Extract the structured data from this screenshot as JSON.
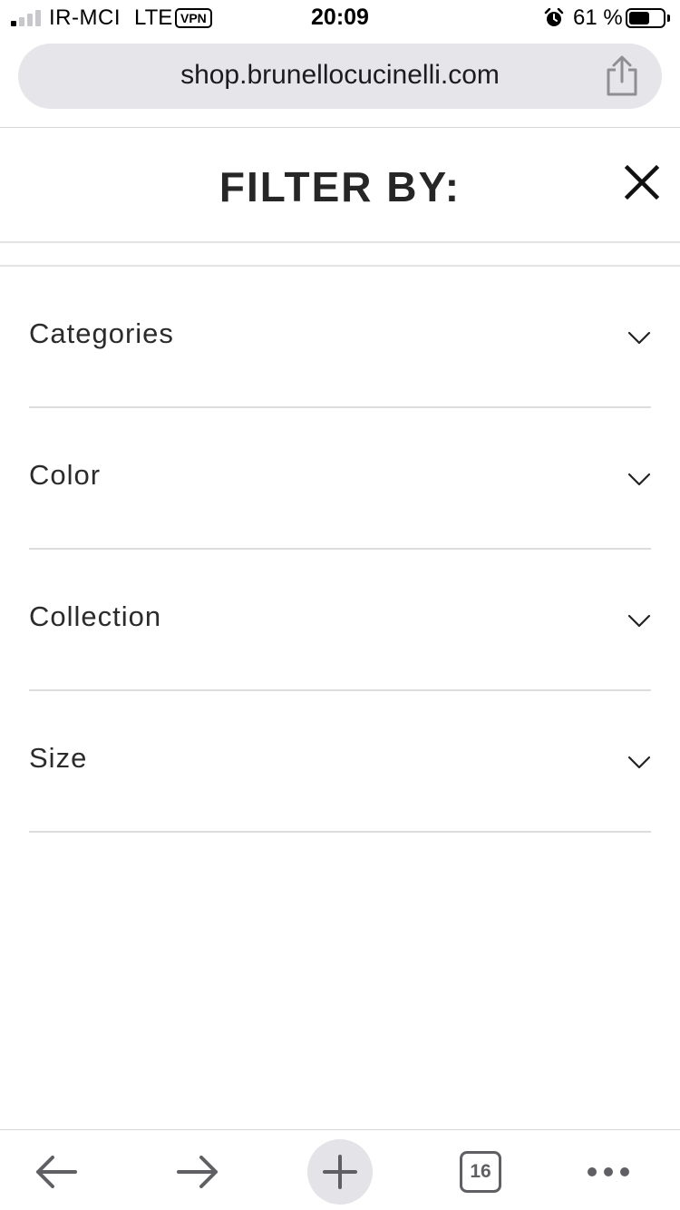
{
  "status_bar": {
    "carrier": "IR-MCI",
    "network": "LTE",
    "vpn_badge": "VPN",
    "time": "20:09",
    "battery_percent": "61 %",
    "battery_level": 0.61,
    "signal_bars_active": 1,
    "signal_bars_total": 4
  },
  "browser": {
    "url": "shop.brunellocucinelli.com",
    "icons": {
      "share": "share-icon",
      "back": "arrow-left-icon",
      "forward": "arrow-right-icon",
      "new_tab": "plus-icon",
      "more": "more-dots-icon"
    },
    "tab_count": "16"
  },
  "filter": {
    "title": "FILTER BY:",
    "close_icon": "close-icon",
    "items": [
      {
        "label": "Categories"
      },
      {
        "label": "Color"
      },
      {
        "label": "Collection"
      },
      {
        "label": "Size"
      }
    ],
    "expand_icon": "chevron-down-icon"
  },
  "colors": {
    "background": "#ffffff",
    "url_bar": "#e5e5ea",
    "text_primary": "#262626",
    "toolbar_icon": "#5f5f64",
    "divider": "#dcdcdc"
  }
}
